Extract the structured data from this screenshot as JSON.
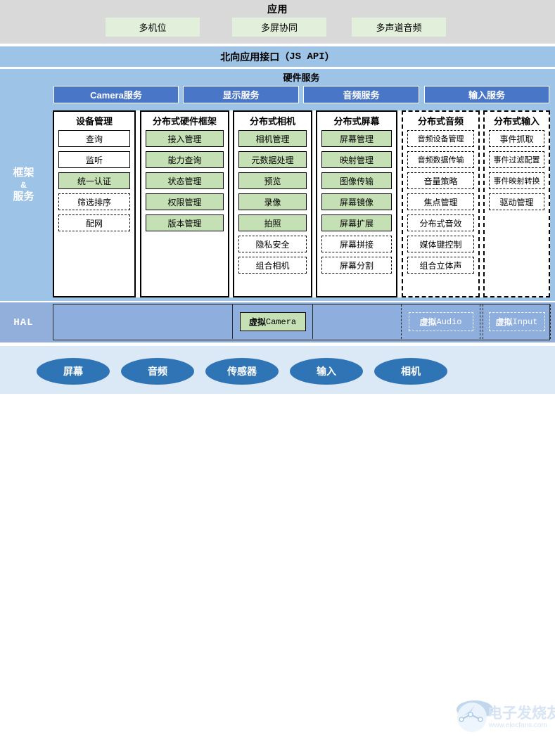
{
  "app_layer": {
    "title": "应用",
    "boxes": [
      {
        "label": "多机位"
      },
      {
        "label": "多屏协同"
      },
      {
        "label": "多声道音频"
      }
    ]
  },
  "api_layer": {
    "label_prefix": "北向应用接口（",
    "label_mono": "JS API",
    "label_suffix": "）"
  },
  "framework_layer": {
    "side_label_line1": "框架",
    "side_label_amp": "&",
    "side_label_line2": "服务",
    "hardware_services": {
      "title": "硬件服务",
      "buttons": [
        {
          "label": "Camera服务"
        },
        {
          "label": "显示服务"
        },
        {
          "label": "音频服务"
        },
        {
          "label": "输入服务"
        }
      ]
    },
    "columns": [
      {
        "header": "设备管理",
        "border": "solid",
        "items": [
          {
            "label": "查询",
            "style": "white-solid"
          },
          {
            "label": "监听",
            "style": "white-solid"
          },
          {
            "label": "统一认证",
            "style": "green-solid"
          },
          {
            "label": "筛选排序",
            "style": "white-dashed"
          },
          {
            "label": "配网",
            "style": "white-dashed"
          }
        ]
      },
      {
        "header": "分布式硬件框架",
        "border": "solid",
        "items": [
          {
            "label": "接入管理",
            "style": "green-solid"
          },
          {
            "label": "能力查询",
            "style": "green-solid"
          },
          {
            "label": "状态管理",
            "style": "green-solid"
          },
          {
            "label": "权限管理",
            "style": "green-solid"
          },
          {
            "label": "版本管理",
            "style": "green-solid"
          }
        ]
      },
      {
        "header": "分布式相机",
        "border": "solid",
        "items": [
          {
            "label": "相机管理",
            "style": "green-solid"
          },
          {
            "label": "元数据处理",
            "style": "green-solid"
          },
          {
            "label": "预览",
            "style": "green-solid"
          },
          {
            "label": "录像",
            "style": "green-solid"
          },
          {
            "label": "拍照",
            "style": "green-solid"
          },
          {
            "label": "隐私安全",
            "style": "white-dashed"
          },
          {
            "label": "组合相机",
            "style": "white-dashed"
          }
        ]
      },
      {
        "header": "分布式屏幕",
        "border": "solid",
        "items": [
          {
            "label": "屏幕管理",
            "style": "green-solid"
          },
          {
            "label": "映射管理",
            "style": "green-solid"
          },
          {
            "label": "图像传输",
            "style": "green-solid"
          },
          {
            "label": "屏幕镜像",
            "style": "green-solid"
          },
          {
            "label": "屏幕扩展",
            "style": "green-solid"
          },
          {
            "label": "屏幕拼接",
            "style": "white-dashed"
          },
          {
            "label": "屏幕分割",
            "style": "white-dashed"
          }
        ]
      },
      {
        "header": "分布式音频",
        "border": "dashed",
        "items": [
          {
            "label": "音频设备管理",
            "style": "white-dashed"
          },
          {
            "label": "音频数据传输",
            "style": "white-dashed"
          },
          {
            "label": "音量策略",
            "style": "white-dashed"
          },
          {
            "label": "焦点管理",
            "style": "white-dashed"
          },
          {
            "label": "分布式音效",
            "style": "white-dashed"
          },
          {
            "label": "媒体键控制",
            "style": "white-dashed"
          },
          {
            "label": "组合立体声",
            "style": "white-dashed"
          }
        ]
      },
      {
        "header": "分布式输入",
        "border": "dashed",
        "items": [
          {
            "label": "事件抓取",
            "style": "white-dashed"
          },
          {
            "label": "事件过滤配置",
            "style": "white-dashed"
          },
          {
            "label": "事件映射转换",
            "style": "white-dashed"
          },
          {
            "label": "驱动管理",
            "style": "white-dashed"
          }
        ]
      }
    ]
  },
  "hal_layer": {
    "side_label": "HAL",
    "boxes": [
      {
        "cn": "虚拟",
        "en": "Camera",
        "style": "green"
      },
      {
        "cn": "虚拟",
        "en": "Audio",
        "style": "vdash"
      },
      {
        "cn": "虚拟",
        "en": "Input",
        "style": "vdash"
      }
    ]
  },
  "driver_layer": {
    "nodes": [
      {
        "label": "屏幕"
      },
      {
        "label": "音频"
      },
      {
        "label": "传感器"
      },
      {
        "label": "输入"
      },
      {
        "label": "相机"
      }
    ]
  },
  "watermark": {
    "text": "电子发烧友",
    "url": "www.elecfans.com"
  },
  "colors": {
    "app_background": "#d9d9d9",
    "app_box": "#e2efda",
    "api_band": "#9dc3e6",
    "framework_band": "#9dc3e6",
    "service_button": "#4a76c8",
    "item_green": "#c5e0b4",
    "hal_band": "#92afdb",
    "driver_band": "#dbe8f5",
    "driver_node": "#2f75b5"
  }
}
